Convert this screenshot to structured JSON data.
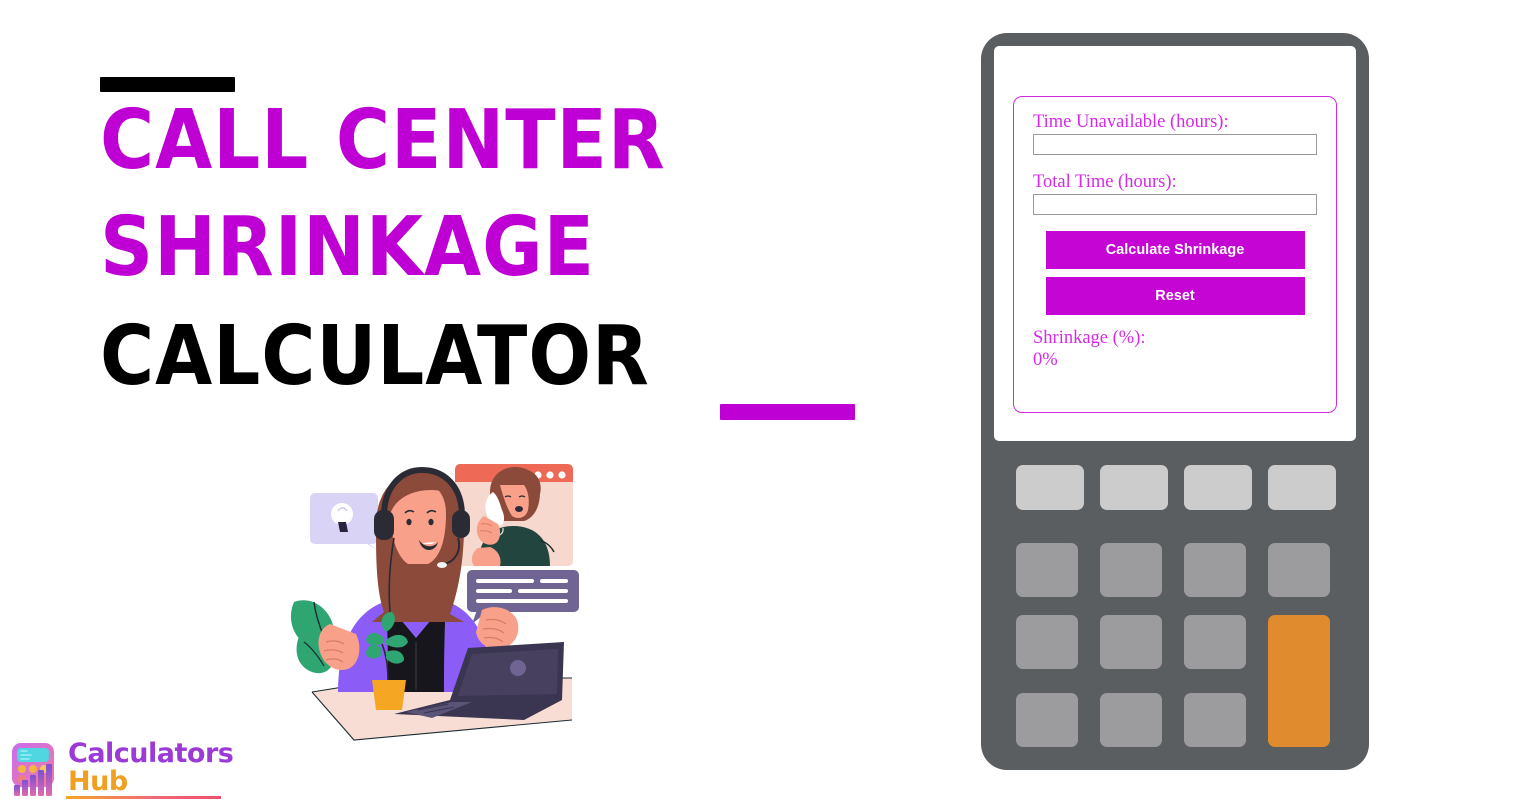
{
  "page": {
    "background_color": "#ffffff",
    "accent_magenta": "#bf00d4",
    "accent_black": "#000000"
  },
  "title_block": {
    "line_1": "Call Center",
    "line_2": "Shrinkage",
    "line_3": "Calculator",
    "line_1_color": "#bf00d4",
    "line_2_color": "#bf00d4",
    "line_3_color": "#000000",
    "top_rule_color": "#000000",
    "bottom_rule_color": "#bf00d4"
  },
  "illustration": {
    "name": "call-center-agent-illustration",
    "desk_color": "#f8ddd4",
    "jacket_color": "#8b5cf6",
    "hair_color": "#8b4a3a",
    "skin_color": "#f9a08a",
    "laptop_color": "#3a3550",
    "plant_pot_color": "#f5a623",
    "leaf_color": "#2fa572",
    "video_window_bar_color": "#ef6a56",
    "video_window_body_color": "#f7d8cf",
    "chat_bubble_color": "#6f6492",
    "idea_bubble_color": "#d9d3f5",
    "headset_color": "#2b2b36",
    "top_color": "#17161c"
  },
  "logo": {
    "name_part_1": "Calculators",
    "name_part_2": "Hub",
    "part_1_color": "#9b3ad6",
    "part_2_color": "#f0a020",
    "icon_name": "calculator-bars-logo-icon",
    "icon_screen_color": "#4fd6e0",
    "icon_body_gradient_from": "#c86cf0",
    "icon_body_gradient_to": "#f07aa0",
    "underline_gradient_from": "#f5a623",
    "underline_gradient_to": "#ef4f6b"
  },
  "calculator": {
    "device_color": "#5b5e61",
    "screen_color": "#ffffff",
    "form_border_color": "#d02ae0",
    "label_color": "#d52ae8",
    "button_color": "#c405d4",
    "button_text_color": "#ffffff",
    "fields": [
      {
        "label": "Time Unavailable (hours):",
        "value": "",
        "placeholder": ""
      },
      {
        "label": "Total Time (hours):",
        "value": "",
        "placeholder": ""
      }
    ],
    "actions": {
      "calculate_label": "Calculate Shrinkage",
      "reset_label": "Reset"
    },
    "result": {
      "label": "Shrinkage (%):",
      "value": "0%"
    },
    "keypad": {
      "key_top_color": "#cccccc",
      "key_standard_color": "#9c9c9e",
      "key_accent_color": "#e08b2d",
      "rows": 4,
      "columns": 4
    }
  }
}
